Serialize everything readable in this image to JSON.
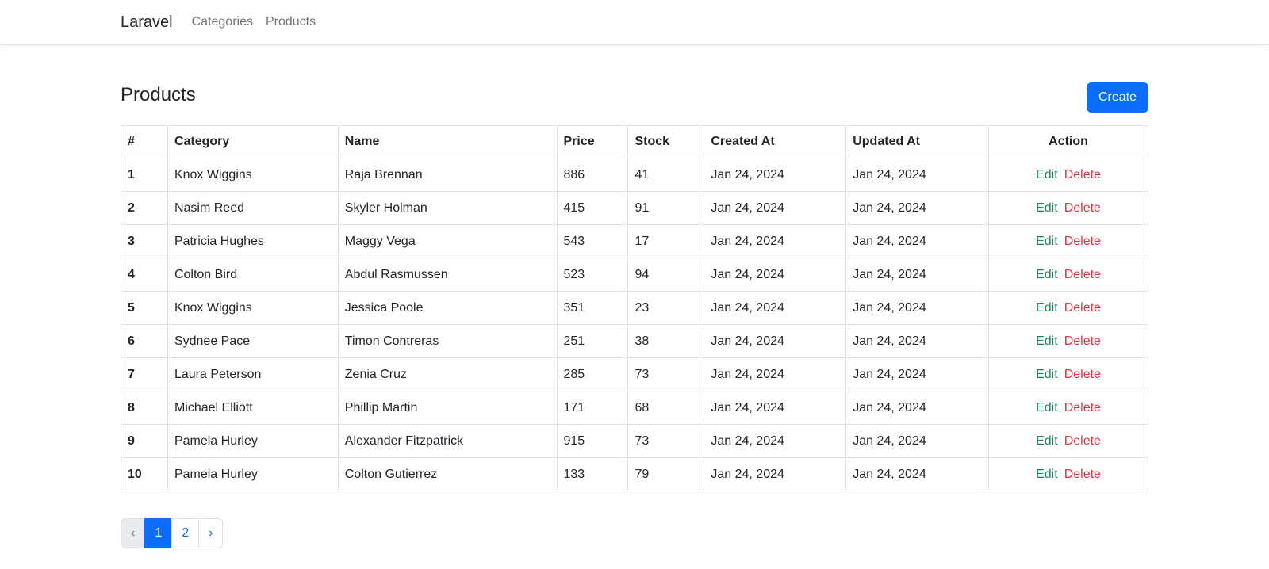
{
  "navbar": {
    "brand": "Laravel",
    "links": [
      "Categories",
      "Products"
    ]
  },
  "page": {
    "title": "Products",
    "create_label": "Create"
  },
  "table": {
    "headers": [
      "#",
      "Category",
      "Name",
      "Price",
      "Stock",
      "Created At",
      "Updated At",
      "Action"
    ],
    "rows": [
      [
        "1",
        "Knox Wiggins",
        "Raja Brennan",
        "886",
        "41",
        "Jan 24, 2024",
        "Jan 24, 2024"
      ],
      [
        "2",
        "Nasim Reed",
        "Skyler Holman",
        "415",
        "91",
        "Jan 24, 2024",
        "Jan 24, 2024"
      ],
      [
        "3",
        "Patricia Hughes",
        "Maggy Vega",
        "543",
        "17",
        "Jan 24, 2024",
        "Jan 24, 2024"
      ],
      [
        "4",
        "Colton Bird",
        "Abdul Rasmussen",
        "523",
        "94",
        "Jan 24, 2024",
        "Jan 24, 2024"
      ],
      [
        "5",
        "Knox Wiggins",
        "Jessica Poole",
        "351",
        "23",
        "Jan 24, 2024",
        "Jan 24, 2024"
      ],
      [
        "6",
        "Sydnee Pace",
        "Timon Contreras",
        "251",
        "38",
        "Jan 24, 2024",
        "Jan 24, 2024"
      ],
      [
        "7",
        "Laura Peterson",
        "Zenia Cruz",
        "285",
        "73",
        "Jan 24, 2024",
        "Jan 24, 2024"
      ],
      [
        "8",
        "Michael Elliott",
        "Phillip Martin",
        "171",
        "68",
        "Jan 24, 2024",
        "Jan 24, 2024"
      ],
      [
        "9",
        "Pamela Hurley",
        "Alexander Fitzpatrick",
        "915",
        "73",
        "Jan 24, 2024",
        "Jan 24, 2024"
      ],
      [
        "10",
        "Pamela Hurley",
        "Colton Gutierrez",
        "133",
        "79",
        "Jan 24, 2024",
        "Jan 24, 2024"
      ]
    ],
    "edit_label": "Edit",
    "delete_label": "Delete"
  },
  "pagination": {
    "prev": "‹",
    "pages": [
      "1",
      "2"
    ],
    "current": "1",
    "next": "›"
  },
  "colors": {
    "primary": "#0d6efd",
    "edit": "#198754",
    "delete": "#dc3545"
  }
}
